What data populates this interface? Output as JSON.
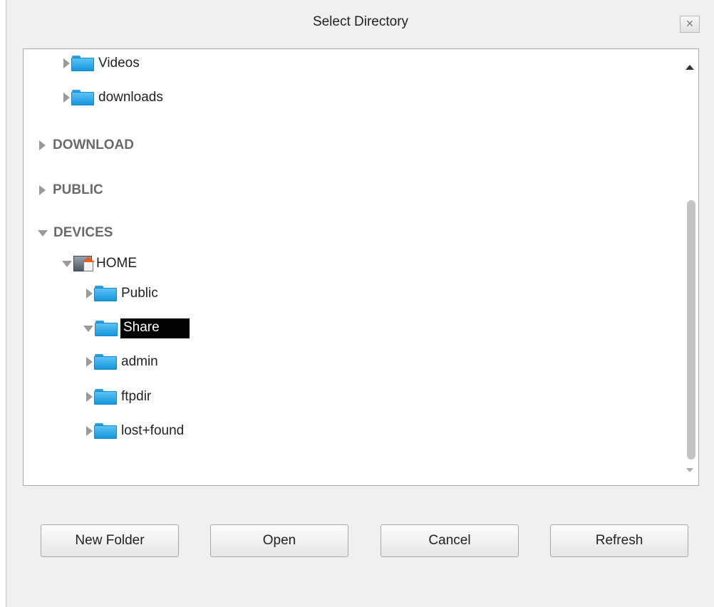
{
  "dialog": {
    "title": "Select Directory",
    "close_label": "×"
  },
  "tree": {
    "partial_items": [
      {
        "label": "Videos"
      },
      {
        "label": "downloads"
      }
    ],
    "sections": [
      {
        "label": "DOWNLOAD",
        "expanded": false
      },
      {
        "label": "PUBLIC",
        "expanded": false
      },
      {
        "label": "DEVICES",
        "expanded": true
      }
    ],
    "device": {
      "label": "HOME",
      "expanded": true
    },
    "children": [
      {
        "label": "Public",
        "expanded": false,
        "selected": false
      },
      {
        "label": "Share",
        "expanded": true,
        "selected": true
      },
      {
        "label": "admin",
        "expanded": false,
        "selected": false
      },
      {
        "label": "ftpdir",
        "expanded": false,
        "selected": false
      },
      {
        "label": "lost+found",
        "expanded": false,
        "selected": false
      }
    ]
  },
  "buttons": {
    "new_folder": "New Folder",
    "open": "Open",
    "cancel": "Cancel",
    "refresh": "Refresh"
  },
  "colors": {
    "selection_bg": "#000000",
    "folder_blue": "#1596dd",
    "dialog_bg": "#f0f0f0"
  }
}
